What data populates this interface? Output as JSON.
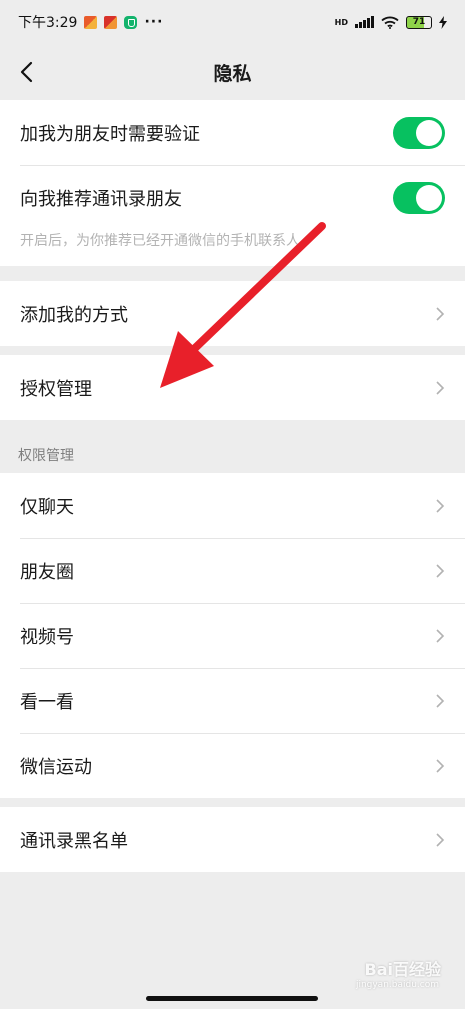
{
  "status_bar": {
    "time": "下午3:29",
    "dots": "···",
    "hd": "HD",
    "battery": "71"
  },
  "nav": {
    "title": "隐私"
  },
  "friend_settings": {
    "verify_label": "加我为朋友时需要验证",
    "verify_on": true,
    "recommend_label": "向我推荐通讯录朋友",
    "recommend_on": true,
    "recommend_hint": "开启后，为你推荐已经开通微信的手机联系人。"
  },
  "add_methods": {
    "label": "添加我的方式"
  },
  "auth": {
    "label": "授权管理"
  },
  "permissions": {
    "header": "权限管理",
    "items": [
      {
        "label": "仅聊天"
      },
      {
        "label": "朋友圈"
      },
      {
        "label": "视频号"
      },
      {
        "label": "看一看"
      },
      {
        "label": "微信运动"
      }
    ]
  },
  "blacklist": {
    "label": "通讯录黑名单"
  },
  "watermark": {
    "text": "Bai百经验",
    "sub": "jingyan.baidu.com"
  },
  "colors": {
    "toggle_on": "#07c160",
    "background": "#ededed",
    "annotation_arrow": "#e8202a"
  },
  "icons": {
    "back": "chevron-left-icon",
    "row_arrow": "chevron-right-icon"
  }
}
